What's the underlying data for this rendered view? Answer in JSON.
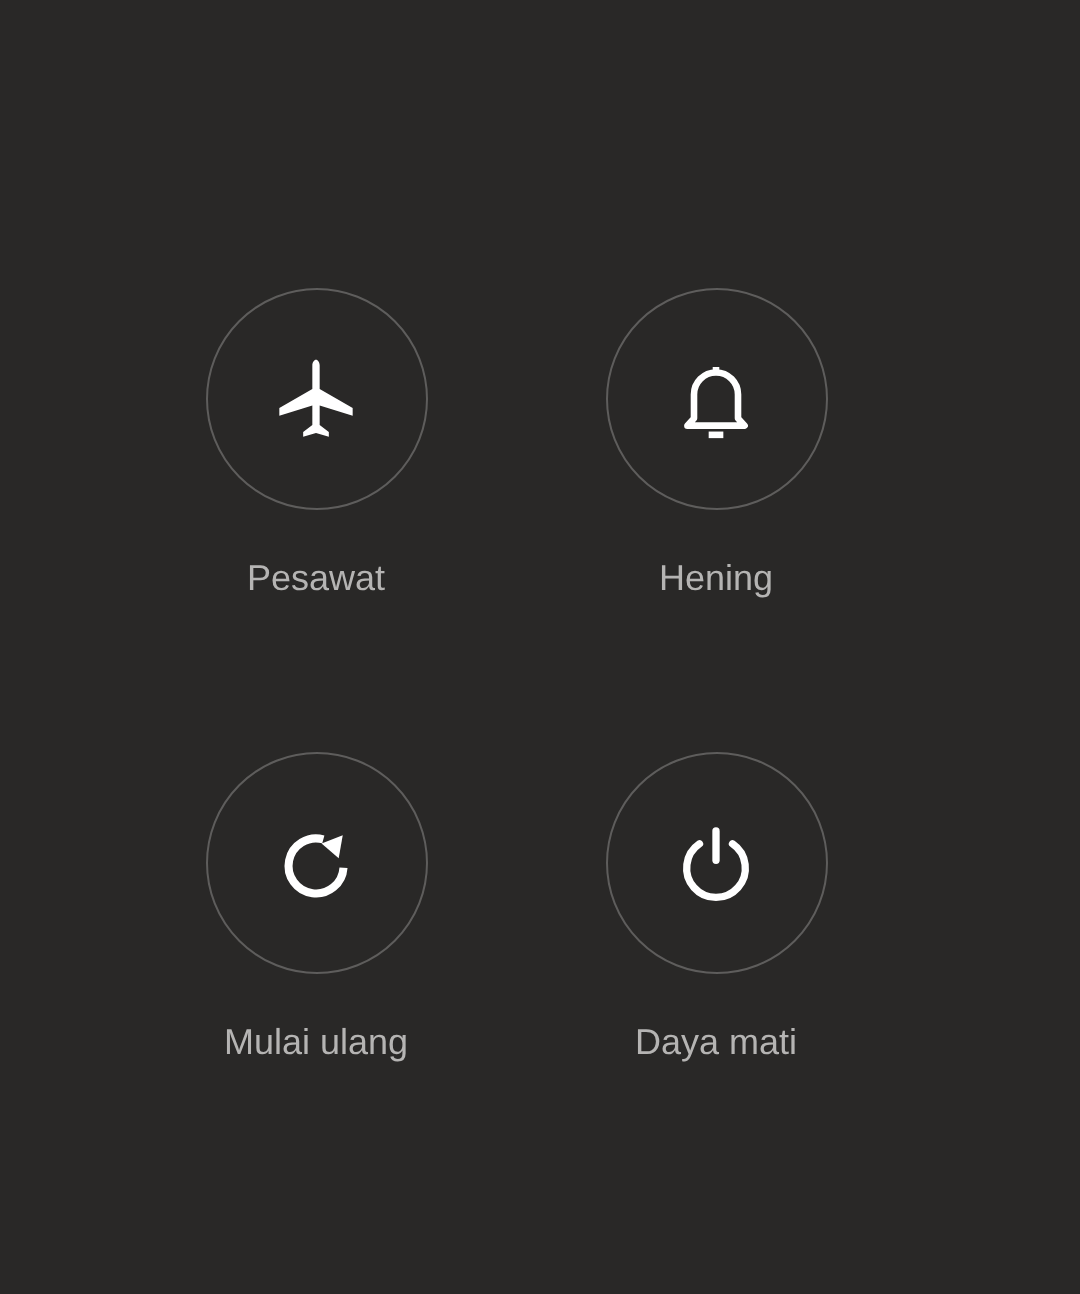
{
  "power_menu": [
    {
      "kind": "airplane",
      "label": "Pesawat"
    },
    {
      "kind": "silent",
      "label": "Hening"
    },
    {
      "kind": "restart",
      "label": "Mulai ulang"
    },
    {
      "kind": "power",
      "label": "Daya mati"
    }
  ]
}
